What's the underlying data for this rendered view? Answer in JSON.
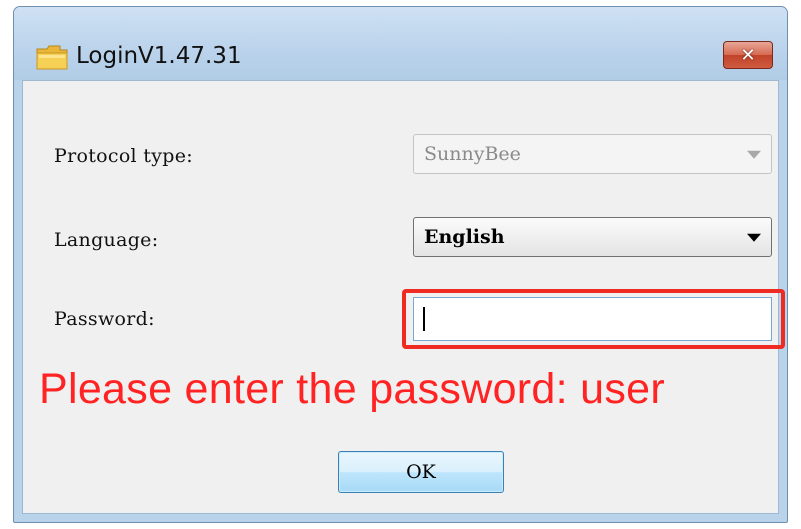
{
  "window": {
    "title": "LoginV1.47.31",
    "close_label": "✕"
  },
  "form": {
    "protocol_label": "Protocol type:",
    "protocol_value": "SunnyBee",
    "language_label": "Language:",
    "language_value": "English",
    "password_label": "Password:",
    "password_value": ""
  },
  "annotation": {
    "hint": "Please enter the password: user",
    "color": "#ff2323"
  },
  "actions": {
    "ok_label": "OK"
  }
}
